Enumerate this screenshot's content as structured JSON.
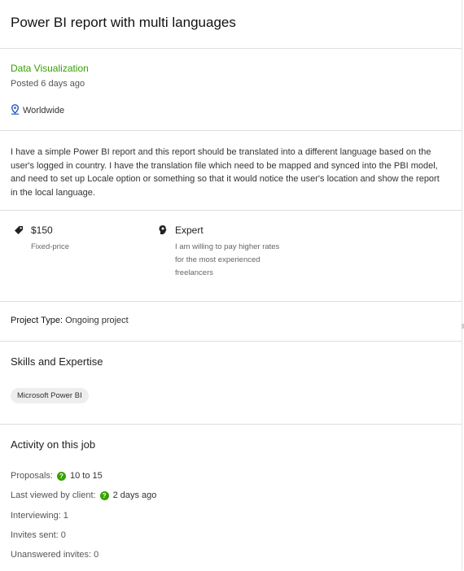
{
  "header": {
    "title": "Power BI report with multi languages"
  },
  "meta": {
    "category": "Data Visualization",
    "posted": "Posted 6 days ago",
    "location": "Worldwide",
    "location_icon": "location-pin-icon"
  },
  "description": "I have a simple Power BI report and this report should be translated into a different language based on the user's logged in country. I have  the translation file which need  to be mapped and synced into the PBI model, and need to set up Locale option or something so that it would notice the user's location and show the report in the local language.",
  "budget": {
    "amount": "$150",
    "type": "Fixed-price",
    "icon": "price-tag-icon"
  },
  "experience": {
    "level": "Expert",
    "note_lines": [
      "I am willing to pay higher rates",
      "for the most experienced",
      "freelancers"
    ],
    "icon": "expert-head-icon"
  },
  "project_type": {
    "label": "Project Type:",
    "value": "Ongoing project"
  },
  "skills": {
    "heading": "Skills and Expertise",
    "items": [
      "Microsoft Power BI"
    ]
  },
  "activity": {
    "heading": "Activity on this job",
    "proposals_label": "Proposals:",
    "proposals_value": "10 to 15",
    "last_viewed_label": "Last viewed by client:",
    "last_viewed_value": "2 days ago",
    "interviewing": "Interviewing: 1",
    "invites_sent": "Invites sent: 0",
    "unanswered": "Unanswered invites: 0",
    "help_icon": "question-circle-icon"
  },
  "colors": {
    "accent_green": "#37a000",
    "pin_blue": "#1f57c3",
    "divider": "#dedede"
  }
}
